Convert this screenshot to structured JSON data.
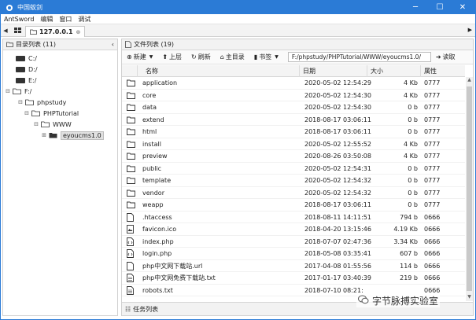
{
  "window": {
    "title": "中国蚁剑"
  },
  "menu": [
    "AntSword",
    "编辑",
    "窗口",
    "调试"
  ],
  "tabs": {
    "active_label": "127.0.0.1"
  },
  "dir_panel": {
    "title": "目录列表 (11)",
    "items": [
      {
        "label": "C:/",
        "expander": ""
      },
      {
        "label": "D:/",
        "expander": ""
      },
      {
        "label": "E:/",
        "expander": ""
      },
      {
        "label": "F:/",
        "expander": "⊟"
      },
      {
        "label": "phpstudy",
        "expander": "⊟"
      },
      {
        "label": "PHPTutorial",
        "expander": "⊟"
      },
      {
        "label": "WWW",
        "expander": "⊟"
      },
      {
        "label": "eyoucms1.0",
        "expander": "⊞"
      }
    ]
  },
  "file_panel": {
    "title": "文件列表 (19)",
    "toolbar": {
      "new": "新建",
      "up": "上层",
      "refresh": "刷新",
      "home": "主目录",
      "bookmark": "书签",
      "path": "F:/phpstudy/PHPTutorial/WWW/eyoucms1.0/",
      "go": "读取"
    },
    "columns": [
      "名称",
      "日期",
      "大小",
      "属性"
    ],
    "files": [
      {
        "name": "application",
        "date": "2020-05-02 12:54:29",
        "size": "4 Kb",
        "attr": "0777",
        "type": "folder"
      },
      {
        "name": "core",
        "date": "2020-05-02 12:54:30",
        "size": "4 Kb",
        "attr": "0777",
        "type": "folder"
      },
      {
        "name": "data",
        "date": "2020-05-02 12:54:30",
        "size": "0 b",
        "attr": "0777",
        "type": "folder"
      },
      {
        "name": "extend",
        "date": "2018-08-17 03:06:11",
        "size": "0 b",
        "attr": "0777",
        "type": "folder"
      },
      {
        "name": "html",
        "date": "2018-08-17 03:06:11",
        "size": "0 b",
        "attr": "0777",
        "type": "folder"
      },
      {
        "name": "install",
        "date": "2020-05-02 12:55:52",
        "size": "4 Kb",
        "attr": "0777",
        "type": "folder"
      },
      {
        "name": "preview",
        "date": "2020-08-26 03:50:08",
        "size": "4 Kb",
        "attr": "0777",
        "type": "folder"
      },
      {
        "name": "public",
        "date": "2020-05-02 12:54:31",
        "size": "0 b",
        "attr": "0777",
        "type": "folder"
      },
      {
        "name": "template",
        "date": "2020-05-02 12:54:32",
        "size": "0 b",
        "attr": "0777",
        "type": "folder"
      },
      {
        "name": "vendor",
        "date": "2020-05-02 12:54:32",
        "size": "0 b",
        "attr": "0777",
        "type": "folder"
      },
      {
        "name": "weapp",
        "date": "2018-08-17 03:06:11",
        "size": "0 b",
        "attr": "0777",
        "type": "folder"
      },
      {
        "name": ".htaccess",
        "date": "2018-08-11 14:11:51",
        "size": "794 b",
        "attr": "0666",
        "type": "file"
      },
      {
        "name": "favicon.ico",
        "date": "2018-04-20 13:15:46",
        "size": "4.19 Kb",
        "attr": "0666",
        "type": "image"
      },
      {
        "name": "index.php",
        "date": "2018-07-07 02:47:36",
        "size": "3.34 Kb",
        "attr": "0666",
        "type": "code"
      },
      {
        "name": "login.php",
        "date": "2018-05-08 03:35:41",
        "size": "607 b",
        "attr": "0666",
        "type": "code"
      },
      {
        "name": "php中文网下载站.url",
        "date": "2017-04-08 01:55:56",
        "size": "114 b",
        "attr": "0666",
        "type": "file"
      },
      {
        "name": "php中文网免费下载站.txt",
        "date": "2017-01-17 03:40:39",
        "size": "219 b",
        "attr": "0666",
        "type": "text"
      },
      {
        "name": "robots.txt",
        "date": "2018-07-10 08:21:",
        "size": "",
        "attr": "0666",
        "type": "text"
      }
    ]
  },
  "status": {
    "task_list": "任务列表"
  },
  "watermark": {
    "text": "字节脉搏实验室"
  },
  "colors": {
    "titlebar": "#2b7bd6",
    "folder": "#333333",
    "drive": "#333333"
  }
}
